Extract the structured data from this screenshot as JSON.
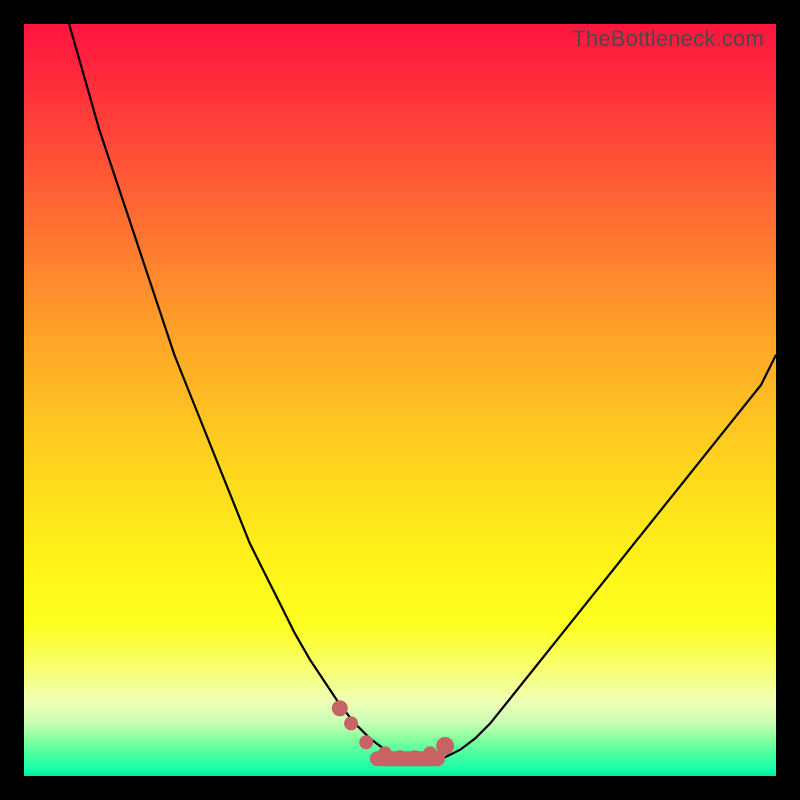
{
  "watermark": "TheBottleneck.com",
  "chart_data": {
    "type": "line",
    "title": "",
    "xlabel": "",
    "ylabel": "",
    "xlim": [
      0,
      100
    ],
    "ylim": [
      0,
      100
    ],
    "series": [
      {
        "name": "bottleneck-curve",
        "x": [
          6,
          8,
          10,
          12,
          14,
          16,
          18,
          20,
          22,
          24,
          26,
          28,
          30,
          32,
          34,
          36,
          38,
          40,
          42,
          44,
          46,
          48,
          50,
          52,
          54,
          56,
          58,
          60,
          62,
          64,
          66,
          68,
          70,
          72,
          74,
          76,
          78,
          80,
          82,
          84,
          86,
          88,
          90,
          92,
          94,
          96,
          98,
          100
        ],
        "y": [
          100,
          93,
          86,
          80,
          74,
          68,
          62,
          56,
          51,
          46,
          41,
          36,
          31,
          27,
          23,
          19,
          15.5,
          12.5,
          9.5,
          7,
          5,
          3.5,
          2.5,
          2,
          2,
          2.5,
          3.5,
          5,
          7,
          9.5,
          12,
          14.5,
          17,
          19.5,
          22,
          24.5,
          27,
          29.5,
          32,
          34.5,
          37,
          39.5,
          42,
          44.5,
          47,
          49.5,
          52,
          56
        ]
      }
    ],
    "markers": {
      "name": "highlight-dots",
      "x": [
        42,
        43.5,
        45.5,
        48,
        50,
        52,
        54,
        56
      ],
      "y": [
        9,
        7,
        4.5,
        3,
        2.5,
        2.5,
        3,
        4
      ],
      "r": [
        8,
        7,
        7,
        7,
        7,
        7,
        7,
        9
      ]
    },
    "flat_region": {
      "x0": 47,
      "x1": 55,
      "y": 2.3
    },
    "colors": {
      "curve": "#000000",
      "marker": "#c76364"
    }
  }
}
